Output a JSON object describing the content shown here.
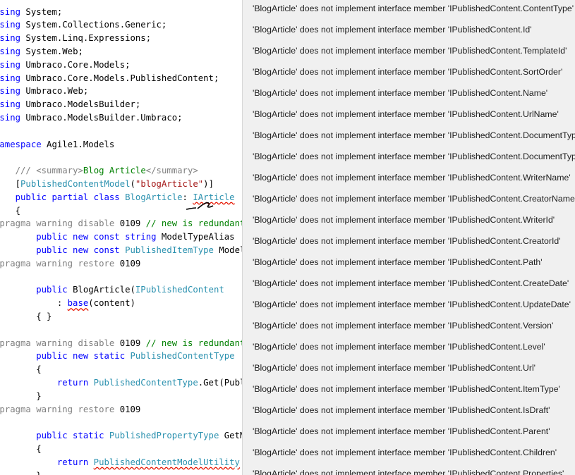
{
  "editor": {
    "lines": [
      [
        {
          "t": "using",
          "c": "kw"
        },
        {
          "t": " System;",
          "c": "pl"
        }
      ],
      [
        {
          "t": "using",
          "c": "kw"
        },
        {
          "t": " System.Collections.Generic;",
          "c": "pl"
        }
      ],
      [
        {
          "t": "using",
          "c": "kw"
        },
        {
          "t": " System.Linq.Expressions;",
          "c": "pl"
        }
      ],
      [
        {
          "t": "using",
          "c": "kw"
        },
        {
          "t": " System.Web;",
          "c": "pl"
        }
      ],
      [
        {
          "t": "using",
          "c": "kw"
        },
        {
          "t": " Umbraco.Core.Models;",
          "c": "pl"
        }
      ],
      [
        {
          "t": "using",
          "c": "kw"
        },
        {
          "t": " Umbraco.Core.Models.PublishedContent;",
          "c": "pl"
        }
      ],
      [
        {
          "t": "using",
          "c": "kw"
        },
        {
          "t": " Umbraco.Web;",
          "c": "pl"
        }
      ],
      [
        {
          "t": "using",
          "c": "kw"
        },
        {
          "t": " Umbraco.ModelsBuilder;",
          "c": "pl"
        }
      ],
      [
        {
          "t": "using",
          "c": "kw"
        },
        {
          "t": " Umbraco.ModelsBuilder.Umbraco;",
          "c": "pl"
        }
      ],
      [],
      [
        {
          "t": "namespace",
          "c": "kw"
        },
        {
          "t": " Agile1.Models",
          "c": "pl"
        }
      ],
      [
        {
          "t": "{",
          "c": "pl"
        }
      ],
      [
        {
          "t": "    ",
          "c": "pl"
        },
        {
          "t": "/// ",
          "c": "doc"
        },
        {
          "t": "<summary>",
          "c": "doc"
        },
        {
          "t": "Blog Article",
          "c": "cm"
        },
        {
          "t": "</summary>",
          "c": "doc"
        }
      ],
      [
        {
          "t": "    [",
          "c": "pl"
        },
        {
          "t": "PublishedContentModel",
          "c": "ty"
        },
        {
          "t": "(",
          "c": "pl"
        },
        {
          "t": "\"blogArticle\"",
          "c": "st"
        },
        {
          "t": ")]",
          "c": "pl"
        }
      ],
      [
        {
          "t": "    ",
          "c": "pl"
        },
        {
          "t": "public partial class ",
          "c": "kw"
        },
        {
          "t": "BlogArticle",
          "c": "ty"
        },
        {
          "t": ": ",
          "c": "pl"
        },
        {
          "t": "IArticle",
          "c": "ty err"
        }
      ],
      [
        {
          "t": "    {",
          "c": "pl"
        }
      ],
      [
        {
          "t": "#pragma warning disable ",
          "c": "pp"
        },
        {
          "t": "0109 ",
          "c": "pl"
        },
        {
          "t": "// new is redundant",
          "c": "cm"
        }
      ],
      [
        {
          "t": "        ",
          "c": "pl"
        },
        {
          "t": "public new const string ",
          "c": "kw"
        },
        {
          "t": "ModelTypeAlias",
          "c": "pl"
        }
      ],
      [
        {
          "t": "        ",
          "c": "pl"
        },
        {
          "t": "public new const ",
          "c": "kw"
        },
        {
          "t": "PublishedItemType ",
          "c": "ty"
        },
        {
          "t": "ModelItemType",
          "c": "pl"
        }
      ],
      [
        {
          "t": "#pragma warning restore ",
          "c": "pp"
        },
        {
          "t": "0109",
          "c": "pl"
        }
      ],
      [],
      [
        {
          "t": "        ",
          "c": "pl"
        },
        {
          "t": "public ",
          "c": "kw"
        },
        {
          "t": "BlogArticle(",
          "c": "pl"
        },
        {
          "t": "IPublishedContent",
          "c": "ty"
        }
      ],
      [
        {
          "t": "            : ",
          "c": "pl"
        },
        {
          "t": "base",
          "c": "kw err"
        },
        {
          "t": "(content)",
          "c": "pl"
        }
      ],
      [
        {
          "t": "        { }",
          "c": "pl"
        }
      ],
      [],
      [
        {
          "t": "#pragma warning disable ",
          "c": "pp"
        },
        {
          "t": "0109 ",
          "c": "pl"
        },
        {
          "t": "// new is redundant",
          "c": "cm"
        }
      ],
      [
        {
          "t": "        ",
          "c": "pl"
        },
        {
          "t": "public new static ",
          "c": "kw"
        },
        {
          "t": "PublishedContentType",
          "c": "ty"
        }
      ],
      [
        {
          "t": "        {",
          "c": "pl"
        }
      ],
      [
        {
          "t": "            ",
          "c": "pl"
        },
        {
          "t": "return ",
          "c": "kw"
        },
        {
          "t": "PublishedContentType",
          "c": "ty"
        },
        {
          "t": ".Get(PublishedItemType",
          "c": "pl"
        }
      ],
      [
        {
          "t": "        }",
          "c": "pl"
        }
      ],
      [
        {
          "t": "#pragma warning restore ",
          "c": "pp"
        },
        {
          "t": "0109",
          "c": "pl"
        }
      ],
      [],
      [
        {
          "t": "        ",
          "c": "pl"
        },
        {
          "t": "public static ",
          "c": "kw"
        },
        {
          "t": "PublishedPropertyType ",
          "c": "ty"
        },
        {
          "t": "GetModelPropertyType",
          "c": "pl"
        }
      ],
      [
        {
          "t": "        {",
          "c": "pl"
        }
      ],
      [
        {
          "t": "            ",
          "c": "pl"
        },
        {
          "t": "return ",
          "c": "kw"
        },
        {
          "t": "PublishedContentModelUtility",
          "c": "ty err"
        }
      ],
      [
        {
          "t": "        }",
          "c": "pl"
        }
      ]
    ]
  },
  "errors": [
    "'BlogArticle' does not implement interface member 'IPublishedContent.ContentType'",
    "'BlogArticle' does not implement interface member 'IPublishedContent.Id'",
    "'BlogArticle' does not implement interface member 'IPublishedContent.TemplateId'",
    "'BlogArticle' does not implement interface member 'IPublishedContent.SortOrder'",
    "'BlogArticle' does not implement interface member 'IPublishedContent.Name'",
    "'BlogArticle' does not implement interface member 'IPublishedContent.UrlName'",
    "'BlogArticle' does not implement interface member 'IPublishedContent.DocumentTypeAlias'",
    "'BlogArticle' does not implement interface member 'IPublishedContent.DocumentTypeId'",
    "'BlogArticle' does not implement interface member 'IPublishedContent.WriterName'",
    "'BlogArticle' does not implement interface member 'IPublishedContent.CreatorName'",
    "'BlogArticle' does not implement interface member 'IPublishedContent.WriterId'",
    "'BlogArticle' does not implement interface member 'IPublishedContent.CreatorId'",
    "'BlogArticle' does not implement interface member 'IPublishedContent.Path'",
    "'BlogArticle' does not implement interface member 'IPublishedContent.CreateDate'",
    "'BlogArticle' does not implement interface member 'IPublishedContent.UpdateDate'",
    "'BlogArticle' does not implement interface member 'IPublishedContent.Version'",
    "'BlogArticle' does not implement interface member 'IPublishedContent.Level'",
    "'BlogArticle' does not implement interface member 'IPublishedContent.Url'",
    "'BlogArticle' does not implement interface member 'IPublishedContent.ItemType'",
    "'BlogArticle' does not implement interface member 'IPublishedContent.IsDraft'",
    "'BlogArticle' does not implement interface member 'IPublishedContent.Parent'",
    "'BlogArticle' does not implement interface member 'IPublishedContent.Children'",
    "'BlogArticle' does not implement interface member 'IPublishedContent.Properties'"
  ],
  "colors": {
    "keyword": "#0000ff",
    "type": "#2b91af",
    "string": "#a31515",
    "comment": "#008000",
    "error_squiggle": "#e51400",
    "tooltip_background": "#f0f0f0"
  }
}
